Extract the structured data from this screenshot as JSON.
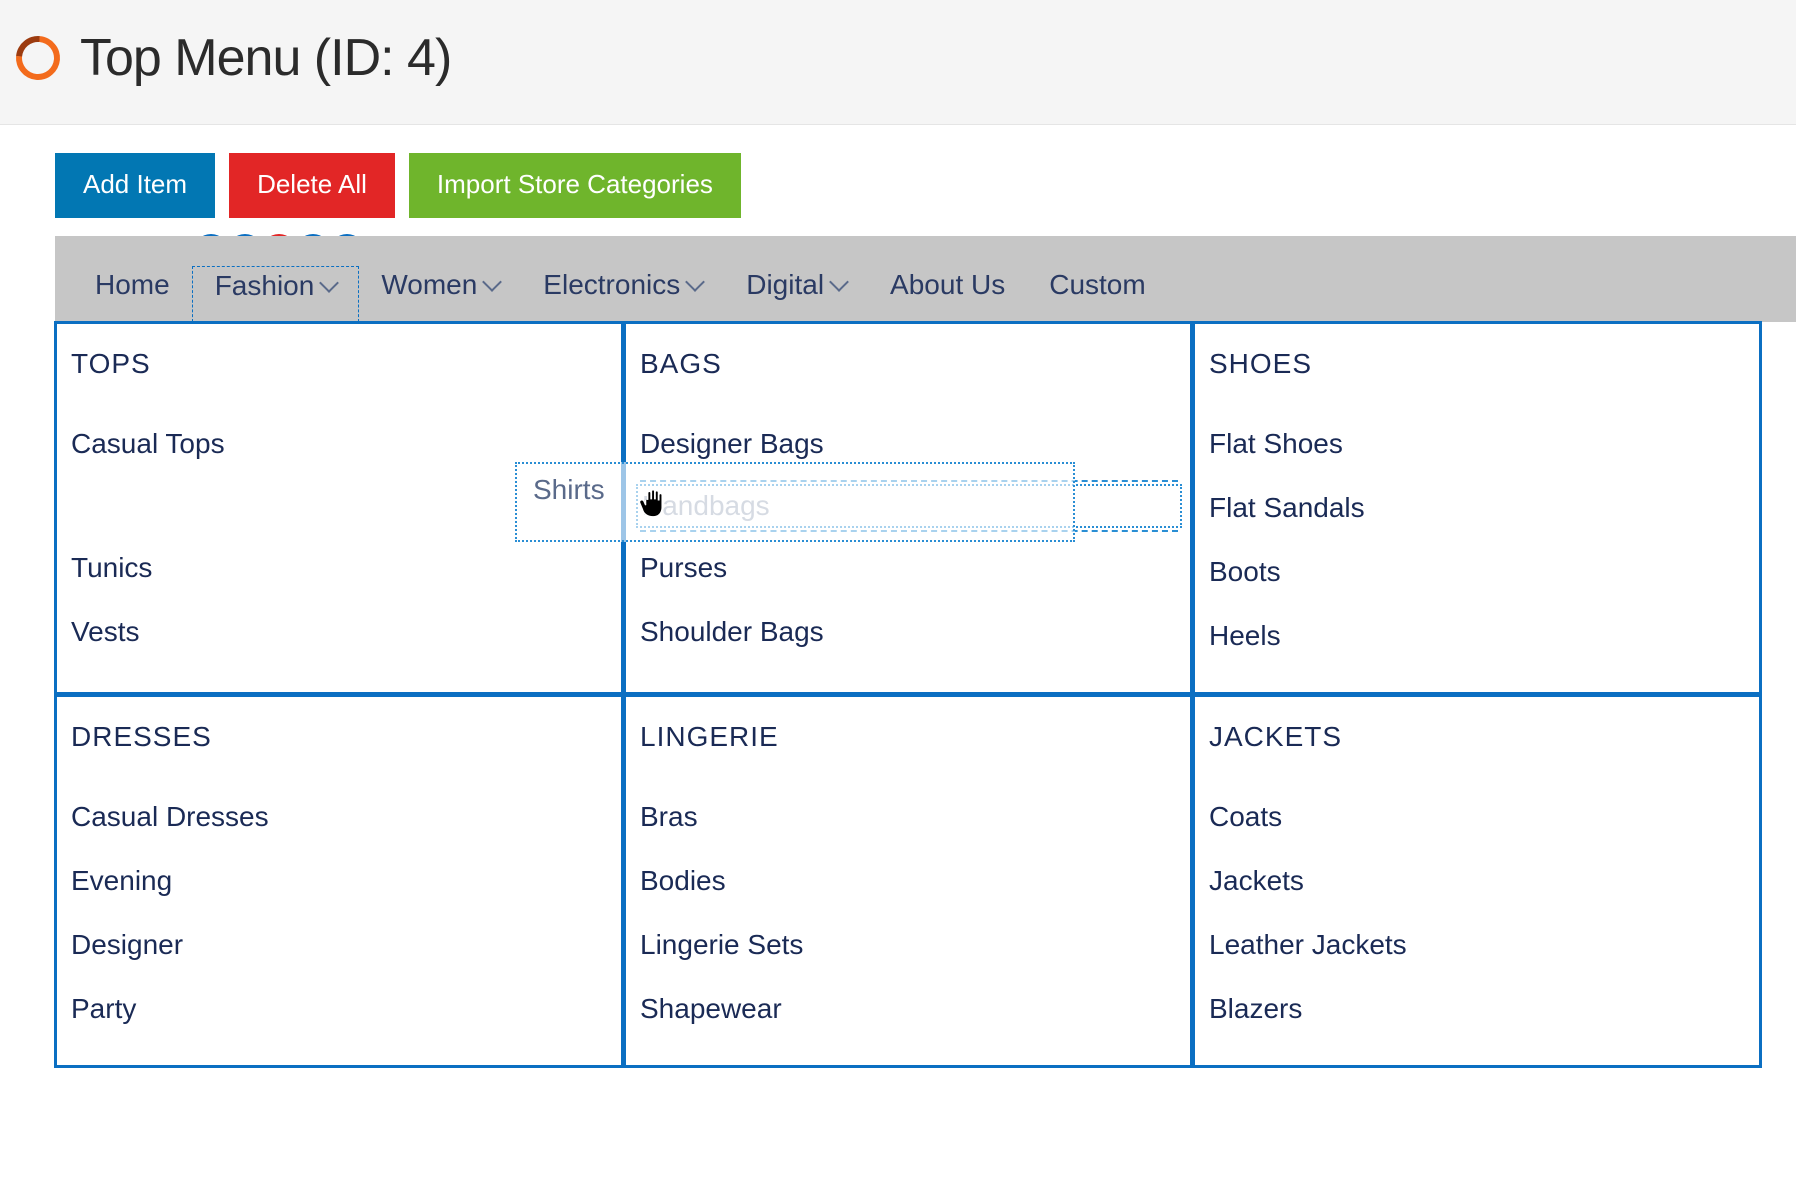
{
  "header": {
    "title": "Top Menu (ID: 4)"
  },
  "actions": {
    "add": "Add Item",
    "delete": "Delete All",
    "import": "Import Store Categories"
  },
  "nav": {
    "items": [
      {
        "label": "Home",
        "dropdown": false
      },
      {
        "label": "Fashion",
        "dropdown": true
      },
      {
        "label": "Women",
        "dropdown": true
      },
      {
        "label": "Electronics",
        "dropdown": true
      },
      {
        "label": "Digital",
        "dropdown": true
      },
      {
        "label": "About Us",
        "dropdown": false
      },
      {
        "label": "Custom",
        "dropdown": false
      }
    ],
    "selected_index": 1
  },
  "drag": {
    "dragging_label": "Shirts",
    "drop_target_label": "Handbags"
  },
  "columns": [
    {
      "title": "TOPS",
      "items": [
        "Casual Tops",
        "Tunics",
        "Vests"
      ]
    },
    {
      "title": "BAGS",
      "items": [
        "Designer Bags",
        "Handbags",
        "Purses",
        "Shoulder Bags"
      ]
    },
    {
      "title": "SHOES",
      "items": [
        "Flat Shoes",
        "Flat Sandals",
        "Boots",
        "Heels"
      ]
    },
    {
      "title": "DRESSES",
      "items": [
        "Casual Dresses",
        "Evening",
        "Designer",
        "Party"
      ]
    },
    {
      "title": "LINGERIE",
      "items": [
        "Bras",
        "Bodies",
        "Lingerie Sets",
        "Shapewear"
      ]
    },
    {
      "title": "JACKETS",
      "items": [
        "Coats",
        "Jackets",
        "Leather Jackets",
        "Blazers"
      ]
    }
  ]
}
